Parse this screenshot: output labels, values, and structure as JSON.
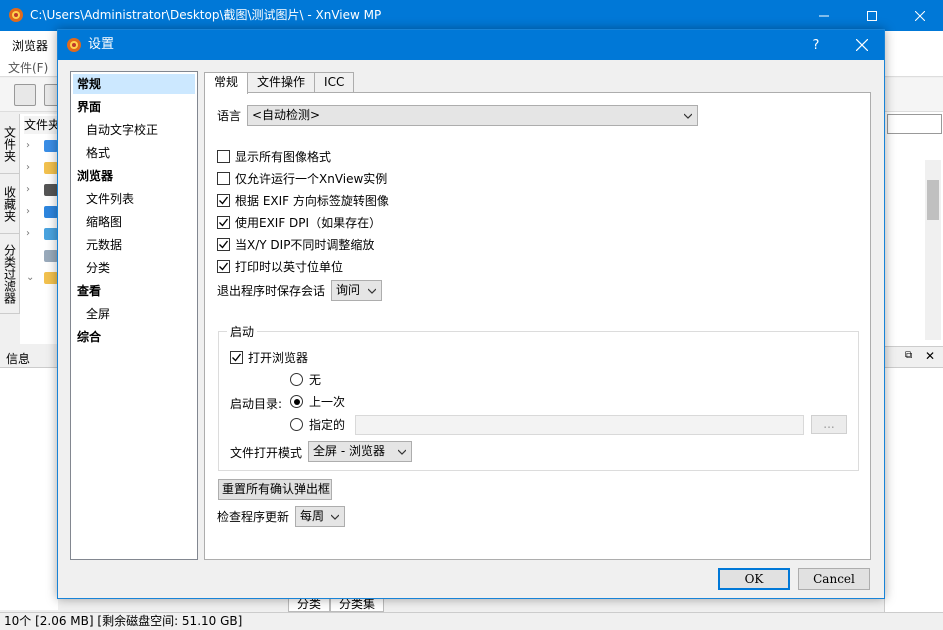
{
  "main_window": {
    "title": "C:\\Users\\Administrator\\Desktop\\截图\\测试图片\\ - XnView MP",
    "browser_tab": "浏览器",
    "menu_file": "文件(F)",
    "folder_panel_label": "文件夹",
    "side_tabs": [
      "文件夹",
      "收藏夹",
      "分类过滤器"
    ],
    "info_label": "信息",
    "bottom_tabs": [
      "分类",
      "分类集"
    ],
    "status": "10个 [2.06 MB] [剩余磁盘空间: 51.10 GB]"
  },
  "dialog": {
    "title": "设置",
    "help": "?",
    "nav": [
      {
        "label": "常规",
        "level": 0,
        "selected": true
      },
      {
        "label": "界面",
        "level": 0
      },
      {
        "label": "自动文字校正",
        "level": 1
      },
      {
        "label": "格式",
        "level": 1
      },
      {
        "label": "浏览器",
        "level": 0
      },
      {
        "label": "文件列表",
        "level": 1
      },
      {
        "label": "缩略图",
        "level": 1
      },
      {
        "label": "元数据",
        "level": 1
      },
      {
        "label": "分类",
        "level": 1
      },
      {
        "label": "查看",
        "level": 0
      },
      {
        "label": "全屏",
        "level": 1
      },
      {
        "label": "综合",
        "level": 0
      }
    ],
    "tabs": [
      {
        "label": "常规",
        "active": true
      },
      {
        "label": "文件操作"
      },
      {
        "label": "ICC"
      }
    ],
    "general": {
      "language_label": "语言",
      "language_value": "<自动检测>",
      "checkboxes": [
        {
          "label": "显示所有图像格式",
          "checked": false
        },
        {
          "label": "仅允许运行一个XnView实例",
          "checked": false
        },
        {
          "label": "根据 EXIF 方向标签旋转图像",
          "checked": true
        },
        {
          "label": "使用EXIF DPI（如果存在）",
          "checked": true
        },
        {
          "label": "当X/Y DIP不同时调整缩放",
          "checked": true
        },
        {
          "label": "打印时以英寸位单位",
          "checked": true
        }
      ],
      "save_session_label": "退出程序时保存会话",
      "save_session_value": "询问",
      "startup": {
        "group_title": "启动",
        "open_browser_label": "打开浏览器",
        "open_browser_checked": true,
        "dir_label": "启动目录:",
        "options": [
          {
            "label": "无",
            "selected": false
          },
          {
            "label": "上一次",
            "selected": true
          },
          {
            "label": "指定的",
            "selected": false
          }
        ],
        "browse_button": "...",
        "file_open_mode_label": "文件打开模式",
        "file_open_mode_value": "全屏 - 浏览器"
      },
      "reset_button": "重置所有确认弹出框",
      "update_label": "检查程序更新",
      "update_value": "每周"
    },
    "ok": "OK",
    "cancel": "Cancel"
  }
}
